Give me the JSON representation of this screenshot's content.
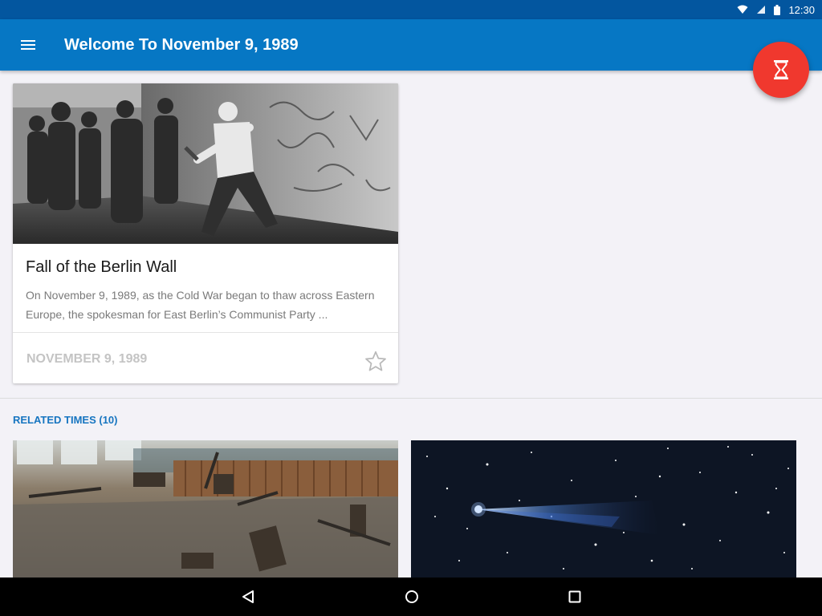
{
  "status_bar": {
    "time": "12:30",
    "icons": [
      "wifi-icon",
      "signal-icon",
      "battery-icon"
    ]
  },
  "app_bar": {
    "title": "Welcome To November 9, 1989",
    "menu_icon": "hamburger-menu-icon"
  },
  "fab": {
    "icon": "hourglass-icon",
    "color": "#f0382e"
  },
  "featured_card": {
    "image": "berlin-wall-photo",
    "title": "Fall of the Berlin Wall",
    "description": "On November 9, 1989, as the Cold War began to thaw across Eastern Europe, the spokesman for East Berlin’s Communist Party ...",
    "date": "NOVEMBER 9, 1989",
    "favorite_icon": "star-outline-icon"
  },
  "related": {
    "label": "RELATED TIMES (10)",
    "items": [
      {
        "image": "abandoned-classroom-photo"
      },
      {
        "image": "comet-night-sky-photo"
      }
    ]
  },
  "nav_bar": {
    "back_icon": "back-triangle-icon",
    "home_icon": "home-circle-icon",
    "recents_icon": "recents-square-icon"
  },
  "colors": {
    "status_bar": "#03569f",
    "app_bar": "#0677c4",
    "accent": "#1675c0",
    "background": "#f3f2f7"
  }
}
